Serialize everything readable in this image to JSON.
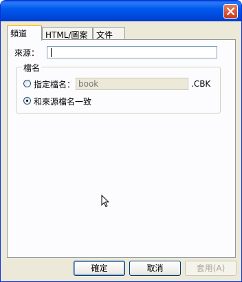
{
  "tabs": [
    {
      "label": "頻道"
    },
    {
      "label": "HTML/圖案"
    },
    {
      "label": "文件"
    }
  ],
  "source": {
    "label": "來源：",
    "value": ""
  },
  "group": {
    "title": "檔名",
    "option_specify_label": "指定檔名：",
    "filename_placeholder": "book",
    "extension": ".CBK",
    "option_same_label": "和來源檔名一致",
    "selected_option": "same-as-source"
  },
  "buttons": {
    "ok": "確定",
    "cancel": "取消",
    "apply": "套用(A)"
  },
  "icons": {
    "close": "close-icon",
    "cursor": "mouse-pointer-icon"
  }
}
